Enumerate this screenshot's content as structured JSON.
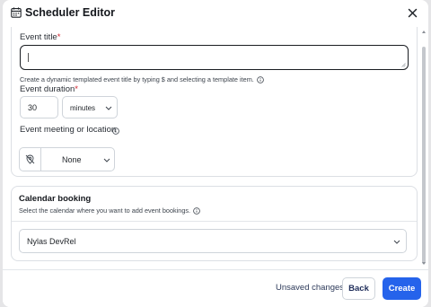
{
  "header": {
    "title": "Scheduler Editor",
    "icon": "calendar-icon",
    "close_icon": "close-icon"
  },
  "event_title": {
    "label": "Event title",
    "required_mark": "*",
    "value": "",
    "hint": "Create a dynamic templated event title by typing $ and selecting a template item."
  },
  "event_duration": {
    "label": "Event duration",
    "required_mark": "*",
    "value": "30",
    "unit": "minutes"
  },
  "event_location": {
    "label": "Event meeting or location",
    "value": "None",
    "icon": "location-off-icon"
  },
  "calendar_booking": {
    "title": "Calendar booking",
    "hint": "Select the calendar where you want to add event bookings.",
    "selected": "Nylas DevRel"
  },
  "footer": {
    "status": "Unsaved changes",
    "back_label": "Back",
    "create_label": "Create"
  },
  "colors": {
    "accent": "#2563eb",
    "required": "#d1242f",
    "status_text": "#2d3a5a"
  }
}
